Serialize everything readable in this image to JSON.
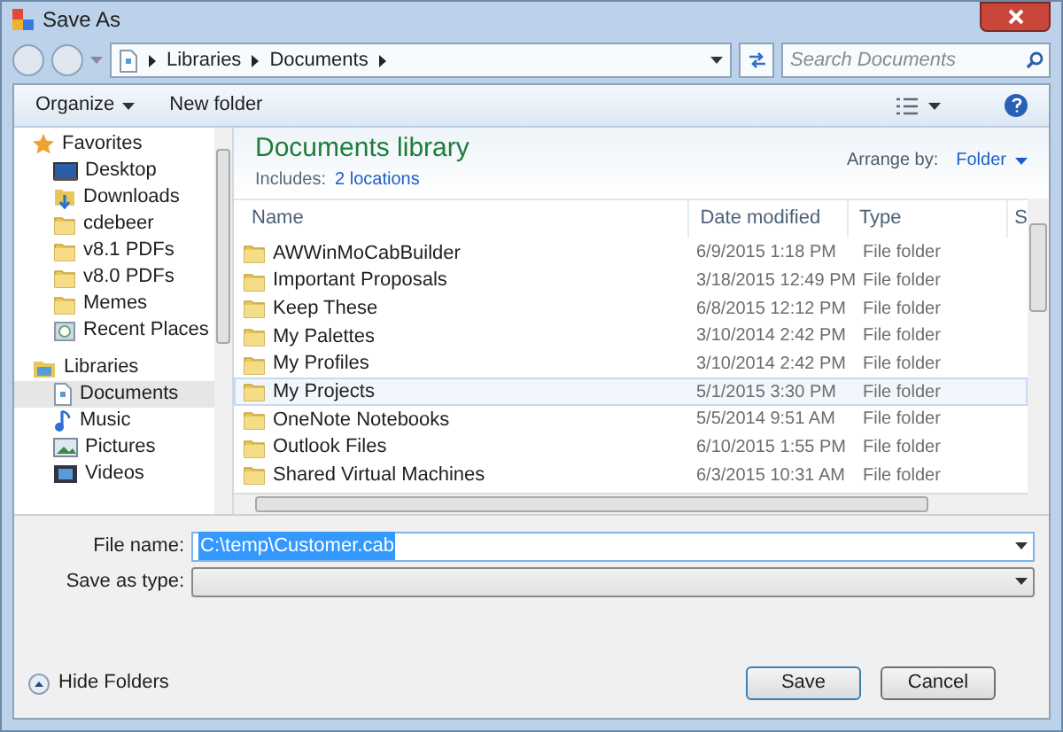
{
  "window": {
    "title": "Save As"
  },
  "address": {
    "crumbs": [
      "Libraries",
      "Documents"
    ],
    "search_placeholder": "Search Documents"
  },
  "toolbar": {
    "organize": "Organize",
    "new_folder": "New folder"
  },
  "sidebar": {
    "sections": [
      {
        "label": "Favorites",
        "kind": "favorites",
        "items": [
          {
            "label": "Desktop",
            "kind": "desktop",
            "selected": false
          },
          {
            "label": "Downloads",
            "kind": "downloads",
            "selected": false
          },
          {
            "label": "cdebeer",
            "kind": "folder",
            "selected": false
          },
          {
            "label": "v8.1 PDFs",
            "kind": "folder",
            "selected": false
          },
          {
            "label": "v8.0 PDFs",
            "kind": "folder",
            "selected": false
          },
          {
            "label": "Memes",
            "kind": "folder",
            "selected": false
          },
          {
            "label": "Recent Places",
            "kind": "recent",
            "selected": false
          }
        ]
      },
      {
        "label": "Libraries",
        "kind": "libraries",
        "items": [
          {
            "label": "Documents",
            "kind": "document",
            "selected": true
          },
          {
            "label": "Music",
            "kind": "music",
            "selected": false
          },
          {
            "label": "Pictures",
            "kind": "pictures",
            "selected": false
          },
          {
            "label": "Videos",
            "kind": "videos",
            "selected": false
          }
        ]
      }
    ]
  },
  "library": {
    "title": "Documents library",
    "includes_label": "Includes:",
    "includes_link": "2 locations",
    "arrange_label": "Arrange by:",
    "arrange_value": "Folder"
  },
  "table": {
    "columns": [
      "Name",
      "Date modified",
      "Type",
      "S"
    ],
    "rows": [
      {
        "name": "AWWinMoCabBuilder",
        "date": "6/9/2015 1:18 PM",
        "type": "File folder",
        "selected": false
      },
      {
        "name": "Important Proposals",
        "date": "3/18/2015 12:49 PM",
        "type": "File folder",
        "selected": false
      },
      {
        "name": "Keep These",
        "date": "6/8/2015 12:12 PM",
        "type": "File folder",
        "selected": false
      },
      {
        "name": "My Palettes",
        "date": "3/10/2014 2:42 PM",
        "type": "File folder",
        "selected": false
      },
      {
        "name": "My Profiles",
        "date": "3/10/2014 2:42 PM",
        "type": "File folder",
        "selected": false
      },
      {
        "name": "My Projects",
        "date": "5/1/2015 3:30 PM",
        "type": "File folder",
        "selected": true
      },
      {
        "name": "OneNote Notebooks",
        "date": "5/5/2014 9:51 AM",
        "type": "File folder",
        "selected": false
      },
      {
        "name": "Outlook Files",
        "date": "6/10/2015 1:55 PM",
        "type": "File folder",
        "selected": false
      },
      {
        "name": "Shared Virtual Machines",
        "date": "6/3/2015 10:31 AM",
        "type": "File folder",
        "selected": false
      }
    ]
  },
  "form": {
    "file_name_label": "File name:",
    "file_name_value": "C:\\temp\\Customer.cab",
    "save_type_label": "Save as type:"
  },
  "footer": {
    "hide_folders": "Hide Folders",
    "buttons": [
      "Save",
      "Cancel"
    ]
  }
}
